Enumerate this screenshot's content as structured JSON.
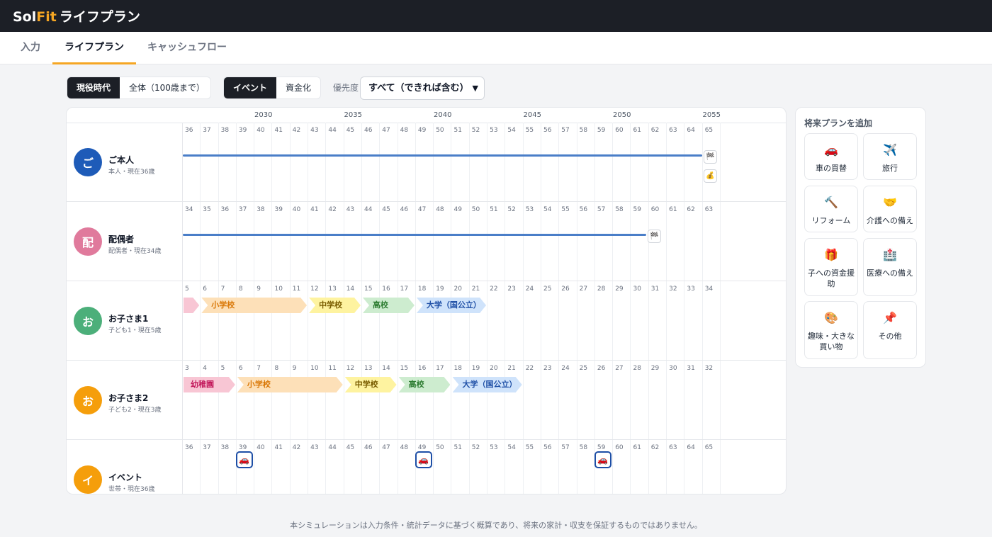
{
  "brand": {
    "sol": "Sol",
    "fit": "Fit",
    "rest": "ライフプラン"
  },
  "tabs": [
    {
      "label": "入力",
      "active": false
    },
    {
      "label": "ライフプラン",
      "active": true
    },
    {
      "label": "キャッシュフロー",
      "active": false
    }
  ],
  "toolbar": {
    "period": {
      "options": [
        "現役時代",
        "全体（100歳まで）"
      ],
      "selected": 0
    },
    "view": {
      "options": [
        "イベント",
        "資金化"
      ],
      "selected": 0
    },
    "priority_label": "優先度",
    "priority_value": "すべて（できれば含む）"
  },
  "years": [
    "2030",
    "2035",
    "2040",
    "2045",
    "2050",
    "2055"
  ],
  "rows": [
    {
      "name": "ご本人",
      "sub": "本人・現在36歳",
      "initial": "ご",
      "color": "#1e5bb8",
      "ages": [
        "36",
        "37",
        "38",
        "39",
        "40",
        "41",
        "42",
        "43",
        "44",
        "45",
        "46",
        "47",
        "48",
        "49",
        "50",
        "51",
        "52",
        "53",
        "54",
        "55",
        "56",
        "57",
        "58",
        "59",
        "60",
        "61",
        "62",
        "63",
        "64",
        "65"
      ]
    },
    {
      "name": "配偶者",
      "sub": "配偶者・現在34歳",
      "initial": "配",
      "color": "#e07a9c",
      "ages": [
        "34",
        "35",
        "36",
        "37",
        "38",
        "39",
        "40",
        "41",
        "42",
        "43",
        "44",
        "45",
        "46",
        "47",
        "48",
        "49",
        "50",
        "51",
        "52",
        "53",
        "54",
        "55",
        "56",
        "57",
        "58",
        "59",
        "60",
        "61",
        "62",
        "63"
      ]
    },
    {
      "name": "お子さま1",
      "sub": "子ども1・現在5歳",
      "initial": "お",
      "color": "#4caf7a",
      "ages": [
        "5",
        "6",
        "7",
        "8",
        "9",
        "10",
        "11",
        "12",
        "13",
        "14",
        "15",
        "16",
        "17",
        "18",
        "19",
        "20",
        "21",
        "22",
        "23",
        "24",
        "25",
        "26",
        "27",
        "28",
        "29",
        "30",
        "31",
        "32",
        "33",
        "34"
      ]
    },
    {
      "name": "お子さま2",
      "sub": "子ども2・現在3歳",
      "initial": "お",
      "color": "#f59e0b",
      "ages": [
        "3",
        "4",
        "5",
        "6",
        "7",
        "8",
        "9",
        "10",
        "11",
        "12",
        "13",
        "14",
        "15",
        "16",
        "17",
        "18",
        "19",
        "20",
        "21",
        "22",
        "23",
        "24",
        "25",
        "26",
        "27",
        "28",
        "29",
        "30",
        "31",
        "32"
      ]
    },
    {
      "name": "イベント",
      "sub": "世帯・現在36歳",
      "initial": "イ",
      "color": "#f59e0b",
      "ages": [
        "36",
        "37",
        "38",
        "39",
        "40",
        "41",
        "42",
        "43",
        "44",
        "45",
        "46",
        "47",
        "48",
        "49",
        "50",
        "51",
        "52",
        "53",
        "54",
        "55",
        "56",
        "57",
        "58",
        "59",
        "60",
        "61",
        "62",
        "63",
        "64",
        "65"
      ]
    }
  ],
  "stages_child1": [
    {
      "label": "",
      "color": "#f8c6d4",
      "text": "#c2185b"
    },
    {
      "label": "小学校",
      "color": "#fde0b8",
      "text": "#d97706"
    },
    {
      "label": "中学校",
      "color": "#fef3a0",
      "text": "#7a5d00"
    },
    {
      "label": "高校",
      "color": "#cdeccf",
      "text": "#2e7d32"
    },
    {
      "label": "大学（国公立）",
      "color": "#cfe3fb",
      "text": "#1e4fa6"
    }
  ],
  "stages_child2": [
    {
      "label": "幼稚園",
      "color": "#f8c6d4",
      "text": "#c2185b"
    },
    {
      "label": "小学校",
      "color": "#fde0b8",
      "text": "#d97706"
    },
    {
      "label": "中学校",
      "color": "#fef3a0",
      "text": "#7a5d00"
    },
    {
      "label": "高校",
      "color": "#cdeccf",
      "text": "#2e7d32"
    },
    {
      "label": "大学（国公立）",
      "color": "#cfe3fb",
      "text": "#1e4fa6"
    }
  ],
  "markers": {
    "goal_icon": "checkered-flag-icon",
    "money_icon": "money-bag-icon",
    "event_icon": "car-icon"
  },
  "add_panel": {
    "title": "将来プランを追加",
    "items": [
      {
        "label": "車の買替",
        "icon": "car-icon"
      },
      {
        "label": "旅行",
        "icon": "airplane-icon"
      },
      {
        "label": "リフォーム",
        "icon": "hammer-icon"
      },
      {
        "label": "介護への備え",
        "icon": "handshake-icon"
      },
      {
        "label": "子への資金援助",
        "icon": "gift-icon"
      },
      {
        "label": "医療への備え",
        "icon": "hospital-icon"
      },
      {
        "label": "趣味・大きな買い物",
        "icon": "palette-icon"
      },
      {
        "label": "その他",
        "icon": "pin-icon"
      }
    ]
  },
  "footer": "本シミュレーションは入力条件・統計データに基づく概算であり、将来の家計・収支を保証するものではありません。"
}
